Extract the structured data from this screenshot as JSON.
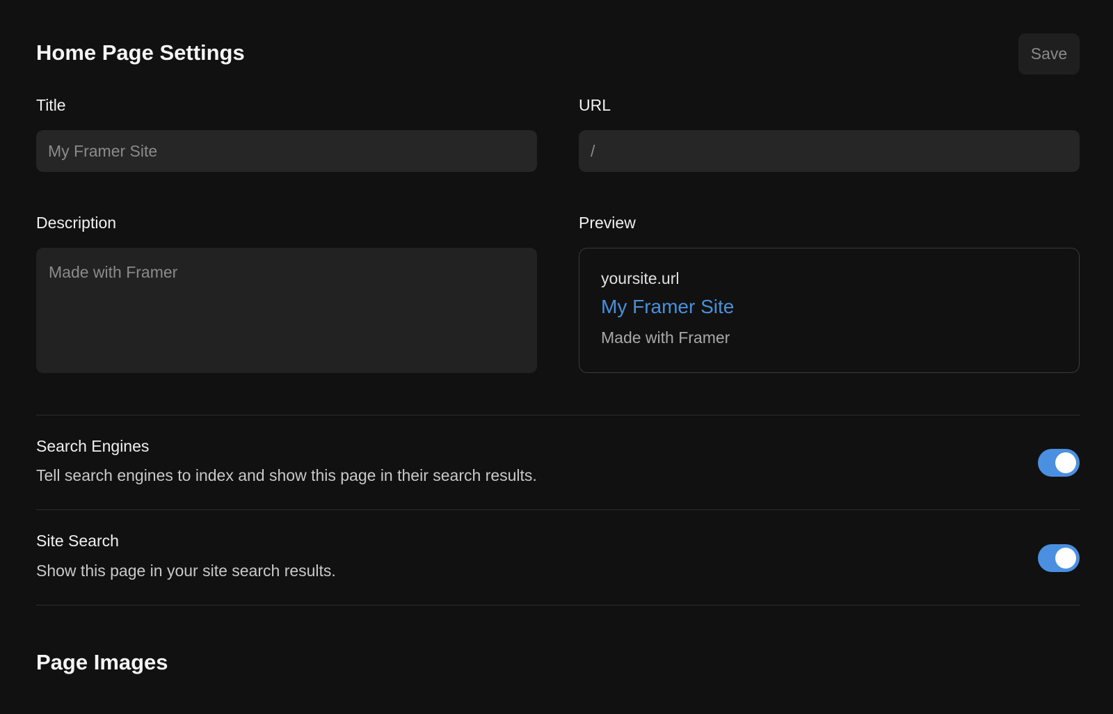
{
  "header": {
    "title": "Home Page Settings",
    "save_label": "Save"
  },
  "fields": {
    "title": {
      "label": "Title",
      "placeholder": "My Framer Site",
      "value": ""
    },
    "url": {
      "label": "URL",
      "placeholder": "/",
      "value": ""
    },
    "description": {
      "label": "Description",
      "placeholder": "Made with Framer",
      "value": ""
    }
  },
  "preview": {
    "label": "Preview",
    "url": "yoursite.url",
    "title": "My Framer Site",
    "description": "Made with Framer"
  },
  "settings": {
    "search_engines": {
      "title": "Search Engines",
      "description": "Tell search engines to index and show this page in their search results.",
      "enabled": true
    },
    "site_search": {
      "title": "Site Search",
      "description": "Show this page in your site search results.",
      "enabled": true
    }
  },
  "sections": {
    "page_images_title": "Page Images"
  },
  "colors": {
    "background": "#111111",
    "accent": "#4a8fe0",
    "link": "#4a90d9"
  }
}
